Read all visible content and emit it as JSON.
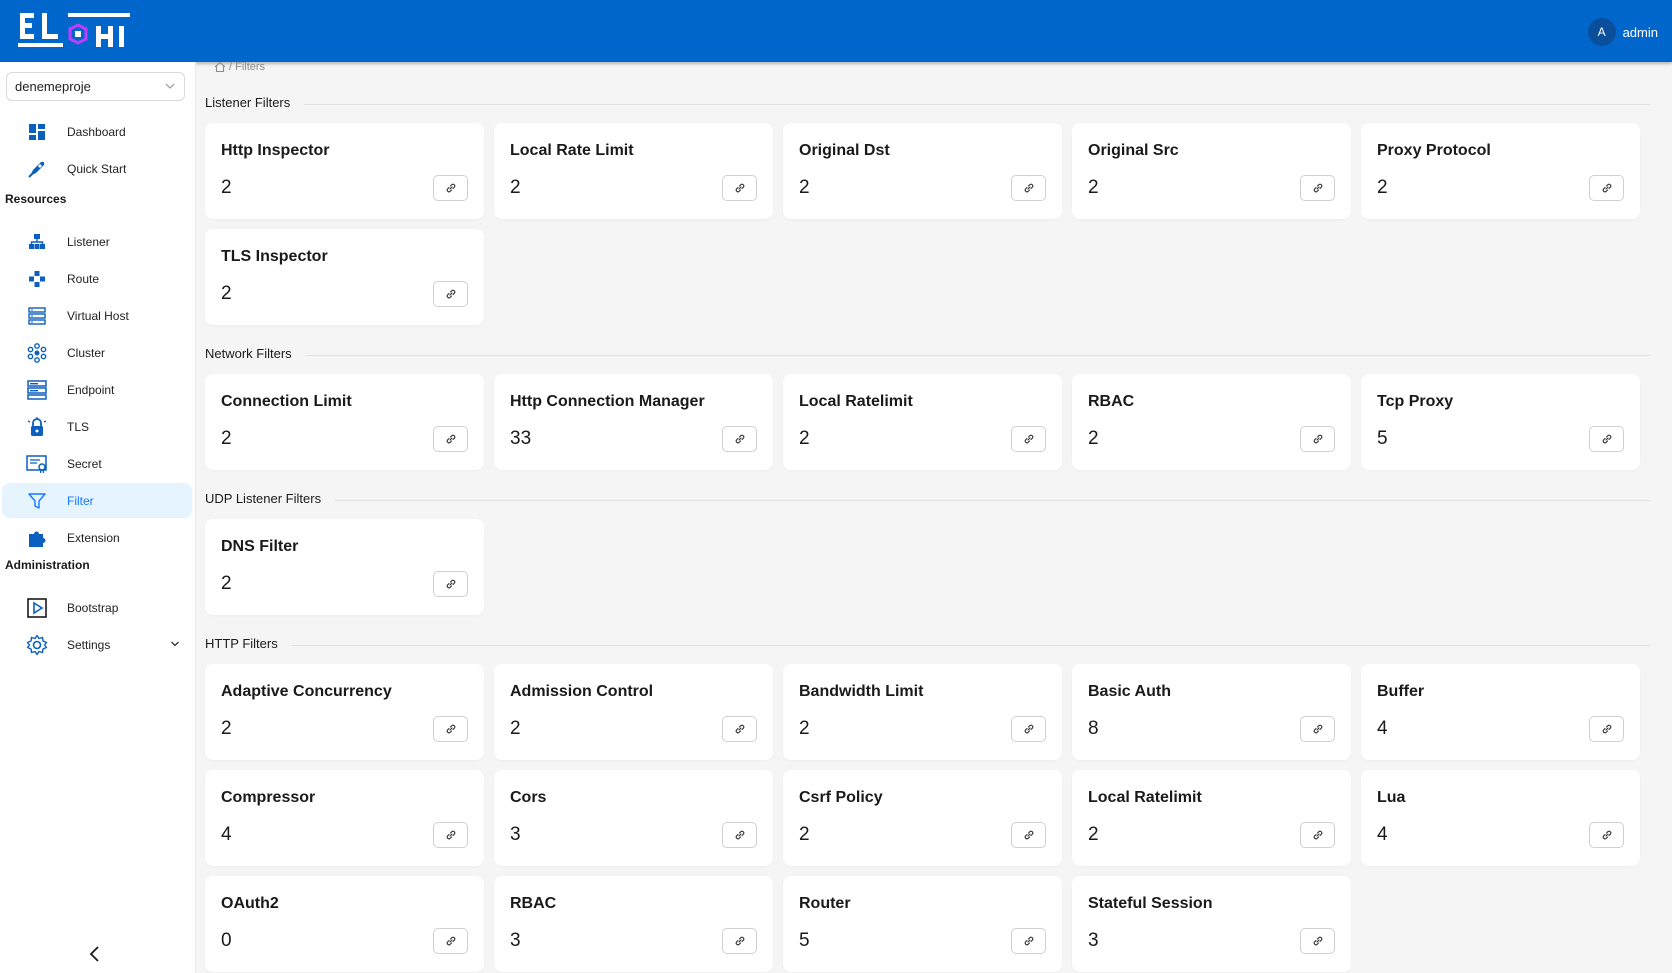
{
  "header": {
    "user_initial": "A",
    "user_name": "admin"
  },
  "project": {
    "selected": "denemeproje"
  },
  "sidebar": {
    "main": [
      {
        "label": "Dashboard",
        "name": "dashboard"
      },
      {
        "label": "Quick Start",
        "name": "quick-start"
      }
    ],
    "resources_label": "Resources",
    "resources": [
      {
        "label": "Listener",
        "name": "listener"
      },
      {
        "label": "Route",
        "name": "route"
      },
      {
        "label": "Virtual Host",
        "name": "virtual-host"
      },
      {
        "label": "Cluster",
        "name": "cluster"
      },
      {
        "label": "Endpoint",
        "name": "endpoint"
      },
      {
        "label": "TLS",
        "name": "tls"
      },
      {
        "label": "Secret",
        "name": "secret"
      },
      {
        "label": "Filter",
        "name": "filter",
        "active": true
      },
      {
        "label": "Extension",
        "name": "extension"
      }
    ],
    "administration_label": "Administration",
    "administration": [
      {
        "label": "Bootstrap",
        "name": "bootstrap"
      },
      {
        "label": "Settings",
        "name": "settings"
      }
    ]
  },
  "breadcrumb": {
    "current": "/ Filters"
  },
  "groups": [
    {
      "title": "Listener Filters",
      "items": [
        {
          "name": "Http Inspector",
          "count": "2"
        },
        {
          "name": "Local Rate Limit",
          "count": "2"
        },
        {
          "name": "Original Dst",
          "count": "2"
        },
        {
          "name": "Original Src",
          "count": "2"
        },
        {
          "name": "Proxy Protocol",
          "count": "2"
        },
        {
          "name": "TLS Inspector",
          "count": "2"
        }
      ]
    },
    {
      "title": "Network Filters",
      "items": [
        {
          "name": "Connection Limit",
          "count": "2"
        },
        {
          "name": "Http Connection Manager",
          "count": "33"
        },
        {
          "name": "Local Ratelimit",
          "count": "2"
        },
        {
          "name": "RBAC",
          "count": "2"
        },
        {
          "name": "Tcp Proxy",
          "count": "5"
        }
      ]
    },
    {
      "title": "UDP Listener Filters",
      "items": [
        {
          "name": "DNS Filter",
          "count": "2"
        }
      ]
    },
    {
      "title": "HTTP Filters",
      "items": [
        {
          "name": "Adaptive Concurrency",
          "count": "2"
        },
        {
          "name": "Admission Control",
          "count": "2"
        },
        {
          "name": "Bandwidth Limit",
          "count": "2"
        },
        {
          "name": "Basic Auth",
          "count": "8"
        },
        {
          "name": "Buffer",
          "count": "4"
        },
        {
          "name": "Compressor",
          "count": "4"
        },
        {
          "name": "Cors",
          "count": "3"
        },
        {
          "name": "Csrf Policy",
          "count": "2"
        },
        {
          "name": "Local Ratelimit",
          "count": "2"
        },
        {
          "name": "Lua",
          "count": "4"
        },
        {
          "name": "OAuth2",
          "count": "0"
        },
        {
          "name": "RBAC",
          "count": "3"
        },
        {
          "name": "Router",
          "count": "5"
        },
        {
          "name": "Stateful Session",
          "count": "3"
        }
      ]
    }
  ],
  "colors": {
    "brand": "#0066cc",
    "accent": "#1677ff",
    "icon": "#0b5fbf"
  }
}
